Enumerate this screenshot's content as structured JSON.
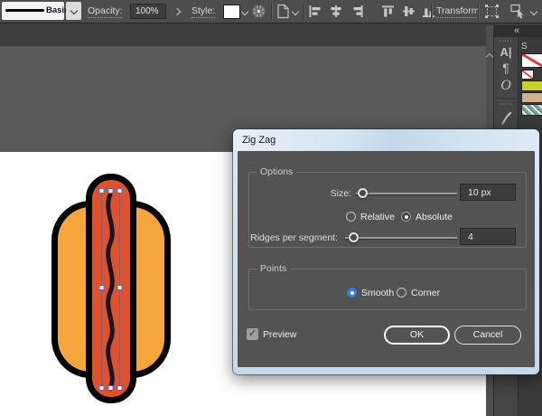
{
  "toolbar": {
    "stroke_style_label": "Basic",
    "opacity_label": "Opacity:",
    "opacity_value": "100%",
    "style_label": "Style:",
    "transform_label": "Transform"
  },
  "dialog": {
    "title": "Zig Zag",
    "options": {
      "label": "Options",
      "size_label": "Size:",
      "size_value": "10 px",
      "relative_label": "Relative",
      "absolute_label": "Absolute",
      "absolute_selected": true,
      "ridges_label": "Ridges per segment:",
      "ridges_value": "4"
    },
    "points": {
      "label": "Points",
      "smooth_label": "Smooth",
      "smooth_selected": true,
      "corner_label": "Corner"
    },
    "preview_label": "Preview",
    "preview_checked": true,
    "ok_label": "OK",
    "cancel_label": "Cancel"
  },
  "dock": {
    "panel_tab": "S",
    "collapse_icon": "«",
    "character_icon": "A|",
    "paragraph_icon": "¶",
    "opentype_icon": "O"
  },
  "icons": {
    "check": "✓"
  },
  "colors": {
    "accent_blue": "#2F80E0",
    "selection_blue": "#5864C8",
    "titlebar_blue": "#D3E2F1",
    "swatch_none_diagonal": "#E03A3A"
  },
  "swatches": {
    "green": "#C6D232",
    "tan": "#CDB190"
  },
  "artwork": {
    "bun": "#F5A73B",
    "sausage": "#DE532A",
    "outline": "#000000",
    "wave": "#16162B",
    "selection": "#5864C8",
    "handle_fill": "#FFFFFF"
  }
}
